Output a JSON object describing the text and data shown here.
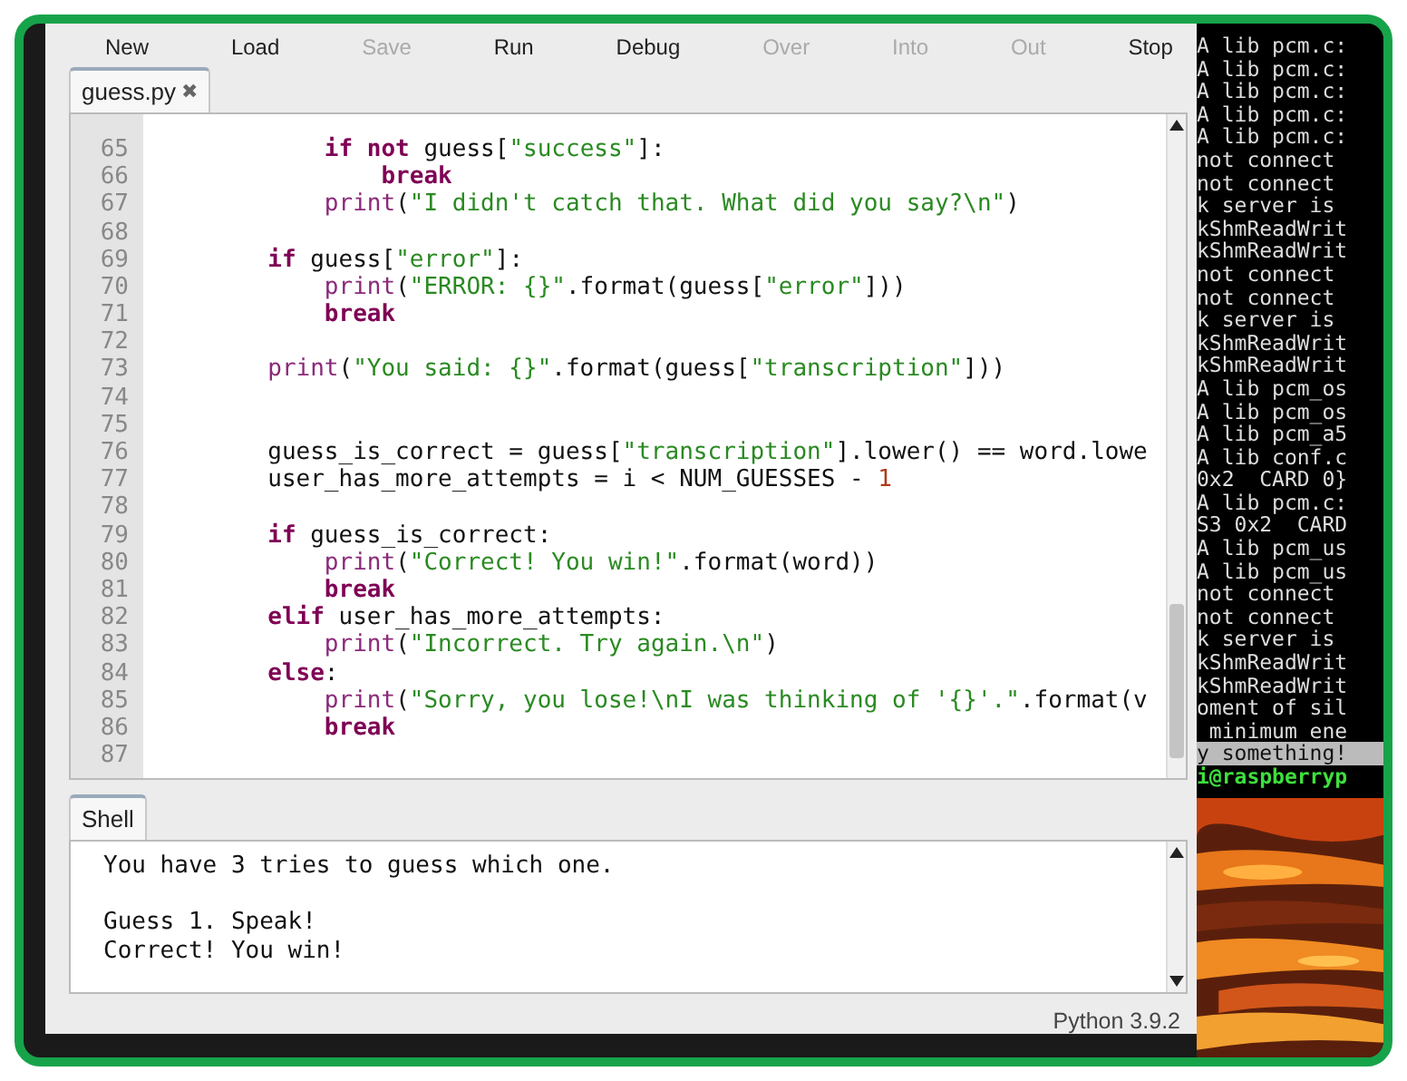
{
  "toolbar": [
    {
      "label": "New",
      "disabled": false
    },
    {
      "label": "Load",
      "disabled": false
    },
    {
      "label": "Save",
      "disabled": true
    },
    {
      "label": "Run",
      "disabled": false
    },
    {
      "label": "Debug",
      "disabled": false
    },
    {
      "label": "Over",
      "disabled": true
    },
    {
      "label": "Into",
      "disabled": true
    },
    {
      "label": "Out",
      "disabled": true
    },
    {
      "label": "Stop",
      "disabled": false
    }
  ],
  "editor": {
    "tab": {
      "label": "guess.py",
      "close": "✖",
      "selected": true
    },
    "lines": [
      {
        "number": "65",
        "tokens": [
          {
            "kind": "keyword",
            "text": "            if not"
          },
          {
            "kind": "plain",
            "text": " guess["
          },
          {
            "kind": "string",
            "text": "\"success\""
          },
          {
            "kind": "plain",
            "text": "]:"
          }
        ]
      },
      {
        "number": "66",
        "tokens": [
          {
            "kind": "keyword",
            "text": "                break"
          }
        ]
      },
      {
        "number": "67",
        "tokens": [
          {
            "kind": "builtin",
            "text": "            print"
          },
          {
            "kind": "plain",
            "text": "("
          },
          {
            "kind": "string",
            "text": "\"I didn't catch that. What did you say?\\n\""
          },
          {
            "kind": "plain",
            "text": ")"
          }
        ]
      },
      {
        "number": "68"
      },
      {
        "number": "69",
        "tokens": [
          {
            "kind": "keyword",
            "text": "        if"
          },
          {
            "kind": "plain",
            "text": " guess["
          },
          {
            "kind": "string",
            "text": "\"error\""
          },
          {
            "kind": "plain",
            "text": "]:"
          }
        ]
      },
      {
        "number": "70",
        "tokens": [
          {
            "kind": "builtin",
            "text": "            print"
          },
          {
            "kind": "plain",
            "text": "("
          },
          {
            "kind": "string",
            "text": "\"ERROR: {}\""
          },
          {
            "kind": "plain",
            "text": ".format(guess["
          },
          {
            "kind": "string",
            "text": "\"error\""
          },
          {
            "kind": "plain",
            "text": "]))"
          }
        ]
      },
      {
        "number": "71",
        "tokens": [
          {
            "kind": "keyword",
            "text": "            break"
          }
        ]
      },
      {
        "number": "72"
      },
      {
        "number": "73",
        "tokens": [
          {
            "kind": "builtin",
            "text": "        print"
          },
          {
            "kind": "plain",
            "text": "("
          },
          {
            "kind": "string",
            "text": "\"You said: {}\""
          },
          {
            "kind": "plain",
            "text": ".format(guess["
          },
          {
            "kind": "string",
            "text": "\"transcription\""
          },
          {
            "kind": "plain",
            "text": "]))"
          }
        ]
      },
      {
        "number": "74"
      },
      {
        "number": "75"
      },
      {
        "number": "76",
        "tokens": [
          {
            "kind": "plain",
            "text": "        guess_is_correct = guess["
          },
          {
            "kind": "string",
            "text": "\"transcription\""
          },
          {
            "kind": "plain",
            "text": "].lower() == word.lowe"
          }
        ]
      },
      {
        "number": "77",
        "tokens": [
          {
            "kind": "plain",
            "text": "        user_has_more_attempts = i < NUM_GUESSES - "
          },
          {
            "kind": "number",
            "text": "1"
          }
        ]
      },
      {
        "number": "78"
      },
      {
        "number": "79",
        "tokens": [
          {
            "kind": "keyword",
            "text": "        if"
          },
          {
            "kind": "plain",
            "text": " guess_is_correct:"
          }
        ]
      },
      {
        "number": "80",
        "tokens": [
          {
            "kind": "builtin",
            "text": "            print"
          },
          {
            "kind": "plain",
            "text": "("
          },
          {
            "kind": "string",
            "text": "\"Correct! You win!\""
          },
          {
            "kind": "plain",
            "text": ".format(word))"
          }
        ]
      },
      {
        "number": "81",
        "tokens": [
          {
            "kind": "keyword",
            "text": "            break"
          }
        ]
      },
      {
        "number": "82",
        "tokens": [
          {
            "kind": "keyword",
            "text": "        elif"
          },
          {
            "kind": "plain",
            "text": " user_has_more_attempts:"
          }
        ]
      },
      {
        "number": "83",
        "tokens": [
          {
            "kind": "builtin",
            "text": "            print"
          },
          {
            "kind": "plain",
            "text": "("
          },
          {
            "kind": "string",
            "text": "\"Incorrect. Try again.\\n\""
          },
          {
            "kind": "plain",
            "text": ")"
          }
        ]
      },
      {
        "number": "84",
        "tokens": [
          {
            "kind": "keyword",
            "text": "        else"
          },
          {
            "kind": "plain",
            "text": ":"
          }
        ]
      },
      {
        "number": "85",
        "tokens": [
          {
            "kind": "builtin",
            "text": "            print"
          },
          {
            "kind": "plain",
            "text": "("
          },
          {
            "kind": "string",
            "text": "\"Sorry, you lose!\\nI was thinking of '{}'.\""
          },
          {
            "kind": "plain",
            "text": ".format(v"
          }
        ]
      },
      {
        "number": "86",
        "tokens": [
          {
            "kind": "keyword",
            "text": "            break"
          }
        ]
      },
      {
        "number": "87"
      }
    ]
  },
  "shell": {
    "tab": {
      "label": "Shell",
      "selected": true
    },
    "paragraphs": [
      {
        "lines": [
          "You have 3 tries to guess which one."
        ]
      },
      {
        "lines": [
          "Guess 1. Speak!",
          "Correct! You win!"
        ]
      }
    ]
  },
  "status_bar": {
    "version": "Python 3.9.2"
  },
  "terminal": {
    "lines": [
      {
        "kind": "plain",
        "text": "A lib pcm.c:"
      },
      {
        "kind": "plain",
        "text": "A lib pcm.c:"
      },
      {
        "kind": "plain",
        "text": "A lib pcm.c:"
      },
      {
        "kind": "plain",
        "text": "A lib pcm.c:"
      },
      {
        "kind": "plain",
        "text": "A lib pcm.c:"
      },
      {
        "kind": "plain",
        "text": "not connect"
      },
      {
        "kind": "plain",
        "text": "not connect"
      },
      {
        "kind": "plain",
        "text": "k server is"
      },
      {
        "kind": "plain",
        "text": "kShmReadWrit"
      },
      {
        "kind": "plain",
        "text": "kShmReadWrit"
      },
      {
        "kind": "plain",
        "text": "not connect"
      },
      {
        "kind": "plain",
        "text": "not connect"
      },
      {
        "kind": "plain",
        "text": "k server is"
      },
      {
        "kind": "plain",
        "text": "kShmReadWrit"
      },
      {
        "kind": "plain",
        "text": "kShmReadWrit"
      },
      {
        "kind": "plain",
        "text": "A lib pcm_os"
      },
      {
        "kind": "plain",
        "text": "A lib pcm_os"
      },
      {
        "kind": "plain",
        "text": "A lib pcm_a5"
      },
      {
        "kind": "plain",
        "text": "A lib conf.c"
      },
      {
        "kind": "plain",
        "text": "0x2  CARD 0}"
      },
      {
        "kind": "plain",
        "text": "A lib pcm.c:"
      },
      {
        "kind": "plain",
        "text": "S3 0x2  CARD"
      },
      {
        "kind": "plain",
        "text": "A lib pcm_us"
      },
      {
        "kind": "plain",
        "text": "A lib pcm_us"
      },
      {
        "kind": "plain",
        "text": "not connect"
      },
      {
        "kind": "plain",
        "text": "not connect"
      },
      {
        "kind": "plain",
        "text": "k server is"
      },
      {
        "kind": "plain",
        "text": "kShmReadWrit"
      },
      {
        "kind": "plain",
        "text": "kShmReadWrit"
      },
      {
        "kind": "plain",
        "text": "oment of sil"
      },
      {
        "kind": "plain",
        "text": " minimum ene"
      },
      {
        "kind": "highlight",
        "text": "y something!"
      },
      {
        "kind": "prompt",
        "text": "i@raspberryp"
      }
    ]
  }
}
